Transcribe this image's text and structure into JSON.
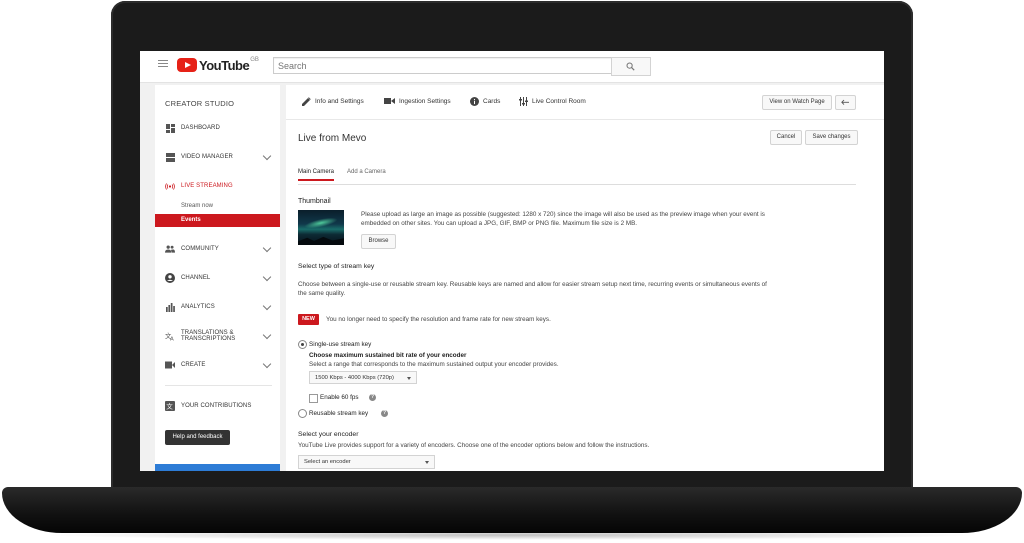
{
  "header": {
    "logo_text": "YouTube",
    "logo_region": "GB",
    "search_placeholder": "Search"
  },
  "sidebar": {
    "title": "CREATOR STUDIO",
    "items": [
      {
        "label": "DASHBOARD",
        "icon": "dashboard-icon"
      },
      {
        "label": "VIDEO MANAGER",
        "icon": "video-manager-icon"
      },
      {
        "label": "LIVE STREAMING",
        "icon": "live-streaming-icon"
      },
      {
        "label": "COMMUNITY",
        "icon": "community-icon"
      },
      {
        "label": "CHANNEL",
        "icon": "channel-icon"
      },
      {
        "label": "ANALYTICS",
        "icon": "analytics-icon"
      },
      {
        "label_line1": "TRANSLATIONS &",
        "label_line2": "TRANSCRIPTIONS",
        "icon": "translate-icon"
      },
      {
        "label": "CREATE",
        "icon": "create-icon"
      },
      {
        "label": "YOUR CONTRIBUTIONS",
        "icon": "contributions-icon"
      }
    ],
    "sub_items": [
      {
        "label": "Stream now"
      },
      {
        "label": "Events"
      }
    ],
    "help_button": "Help and feedback"
  },
  "main": {
    "tabs": [
      {
        "label": "Info and Settings",
        "icon": "pencil-icon"
      },
      {
        "label": "Ingestion Settings",
        "icon": "camera-icon"
      },
      {
        "label": "Cards",
        "icon": "info-icon"
      },
      {
        "label": "Live Control Room",
        "icon": "sliders-icon"
      }
    ],
    "view_watch_page": "View on Watch Page",
    "back_icon": "back-arrow-icon",
    "title": "Live from Mevo",
    "cancel": "Cancel",
    "save": "Save changes",
    "sub_tabs": [
      "Main Camera",
      "Add a Camera"
    ],
    "thumbnail": {
      "heading": "Thumbnail",
      "text_line1": "Please upload as large an image as possible (suggested: 1280 x 720) since the image will also be used as the preview image when your event is",
      "text_line2": "embedded on other sites. You can upload a JPG, GIF, BMP or PNG file. Maximum file size is 2 MB.",
      "browse": "Browse"
    },
    "stream_key": {
      "heading": "Select type of stream key",
      "desc_line1": "Choose between a single-use or reusable stream key. Reusable keys are named and allow for easier stream setup next time, recurring events or simultaneous events of",
      "desc_line2": "the same quality.",
      "new_badge": "NEW",
      "new_text": "You no longer need to specify the resolution and frame rate for new stream keys.",
      "single_use": "Single-use stream key",
      "bitrate_heading": "Choose maximum sustained bit rate of your encoder",
      "bitrate_desc": "Select a range that corresponds to the maximum sustained output your encoder provides.",
      "bitrate_value": "1500 Kbps - 4000 Kbps (720p)",
      "enable_60fps": "Enable 60 fps",
      "reusable": "Reusable stream key"
    },
    "encoder": {
      "heading": "Select your encoder",
      "desc": "YouTube Live provides support for a variety of encoders. Choose one of the encoder options below and follow the instructions.",
      "select_value": "Select an encoder"
    }
  },
  "colors": {
    "brand_red": "#cc181e",
    "youtube_red": "#e62117",
    "frame": "#1b1b1b",
    "accent_blue": "#2d7cd6"
  }
}
